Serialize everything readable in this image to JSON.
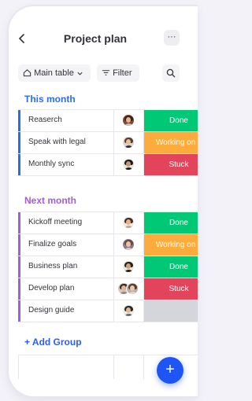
{
  "header": {
    "back_icon": "chevron-left-icon",
    "title": "Project plan",
    "more_icon": "more-dots-icon",
    "more_label": "···"
  },
  "toolbar": {
    "main_table_label": "Main table",
    "filter_label": "Filter",
    "search_icon": "search-icon"
  },
  "colors": {
    "this_month": "#2b6cf5",
    "next_month": "#a25ddc",
    "done": "#00c875",
    "working": "#fdab3d",
    "stuck": "#e2445c",
    "empty": "#c4c4cc",
    "fab": "#1f55f5"
  },
  "groups": [
    {
      "title": "This month",
      "rows": [
        {
          "name": "Reaserch",
          "status": "Done",
          "status_key": "done"
        },
        {
          "name": "Speak with legal",
          "status": "Working on it",
          "status_key": "working"
        },
        {
          "name": "Monthly sync",
          "status": "Stuck",
          "status_key": "stuck"
        }
      ]
    },
    {
      "title": "Next month",
      "rows": [
        {
          "name": "Kickoff meeting",
          "status": "Done",
          "status_key": "done"
        },
        {
          "name": "Finalize goals",
          "status": "Working on it",
          "status_key": "working"
        },
        {
          "name": "Business plan",
          "status": "Done",
          "status_key": "done"
        },
        {
          "name": "Develop plan",
          "status": "Stuck",
          "status_key": "stuck"
        },
        {
          "name": "Design guide",
          "status": "",
          "status_key": "empty"
        }
      ]
    }
  ],
  "add_group_label": "+ Add Group",
  "fab_label": "+"
}
